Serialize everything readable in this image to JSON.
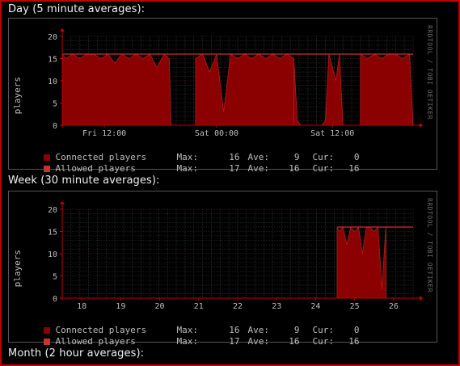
{
  "sections": [
    {
      "title": "Day (5 minute averages):"
    },
    {
      "title": "Week (30 minute averages):"
    },
    {
      "title": "Month (2 hour averages):"
    }
  ],
  "watermark": "RRDTOOL / TOBI OETIKER",
  "colors": {
    "connected": "#8b0000",
    "allowed": "#c83232",
    "grid": "#3a3a3a",
    "axis": "#c00000",
    "background": "#000000"
  },
  "chart_data": [
    {
      "type": "area",
      "ylabel": "players",
      "ylim": [
        0,
        20
      ],
      "yticks": [
        0,
        5,
        10,
        15,
        20
      ],
      "xtick_labels": [
        "Fri 12:00",
        "Sat 00:00",
        "Sat 12:00"
      ],
      "series": [
        {
          "name": "Connected players",
          "segments": [
            {
              "x": [
                0.0,
                0.01,
                0.03,
                0.05,
                0.07,
                0.09,
                0.11,
                0.13,
                0.15,
                0.17,
                0.19,
                0.21,
                0.23,
                0.25,
                0.27,
                0.29,
                0.305,
                0.31
              ],
              "y": [
                16,
                15,
                16,
                15,
                16,
                16,
                15,
                16,
                14,
                16,
                15,
                16,
                15,
                16,
                13,
                16,
                15,
                0
              ]
            },
            {
              "x": [
                0.38,
                0.4,
                0.42,
                0.44,
                0.46,
                0.48,
                0.5,
                0.52,
                0.54,
                0.56,
                0.58,
                0.6,
                0.62,
                0.64,
                0.66
              ],
              "y": [
                15,
                16,
                12,
                16,
                3,
                16,
                15,
                16,
                15,
                16,
                15,
                16,
                15,
                16,
                15
              ]
            },
            {
              "x": [
                0.66,
                0.67,
                0.68,
                0.7
              ],
              "y": [
                15,
                1,
                0,
                0
              ]
            },
            {
              "x": [
                0.74,
                0.75,
                0.76,
                0.78,
                0.79,
                0.8
              ],
              "y": [
                0,
                1,
                16,
                10,
                16,
                0
              ]
            },
            {
              "x": [
                0.85,
                0.87,
                0.89,
                0.91,
                0.93,
                0.95,
                0.97,
                0.99,
                1.0
              ],
              "y": [
                16,
                15,
                16,
                15,
                16,
                16,
                15,
                16,
                0
              ]
            }
          ]
        },
        {
          "name": "Allowed players",
          "value": 16
        }
      ],
      "legend": [
        {
          "name": "Connected players",
          "max": "16",
          "ave": "9",
          "cur": "0"
        },
        {
          "name": "Allowed players",
          "max": "17",
          "ave": "16",
          "cur": "16"
        }
      ]
    },
    {
      "type": "area",
      "ylabel": "players",
      "ylim": [
        0,
        20
      ],
      "yticks": [
        0,
        5,
        10,
        15,
        20
      ],
      "xtick_labels": [
        "18",
        "19",
        "20",
        "21",
        "22",
        "23",
        "24",
        "25",
        "26"
      ],
      "series": [
        {
          "name": "Connected players",
          "segments": [
            {
              "x": [
                7.05,
                7.1,
                7.2,
                7.3,
                7.4,
                7.5,
                7.6,
                7.7,
                7.8,
                7.9,
                8.0,
                8.1,
                8.2,
                8.3
              ],
              "y": [
                16,
                15,
                16,
                12,
                16,
                15,
                16,
                10,
                16,
                16,
                15,
                16,
                2,
                16
              ]
            }
          ]
        },
        {
          "name": "Allowed players",
          "value": 16
        }
      ],
      "legend": [
        {
          "name": "Connected players",
          "max": "16",
          "ave": "9",
          "cur": "0"
        },
        {
          "name": "Allowed players",
          "max": "17",
          "ave": "16",
          "cur": "16"
        }
      ]
    }
  ],
  "legend_labels": {
    "max": "Max:",
    "ave": "Ave:",
    "cur": "Cur:"
  }
}
